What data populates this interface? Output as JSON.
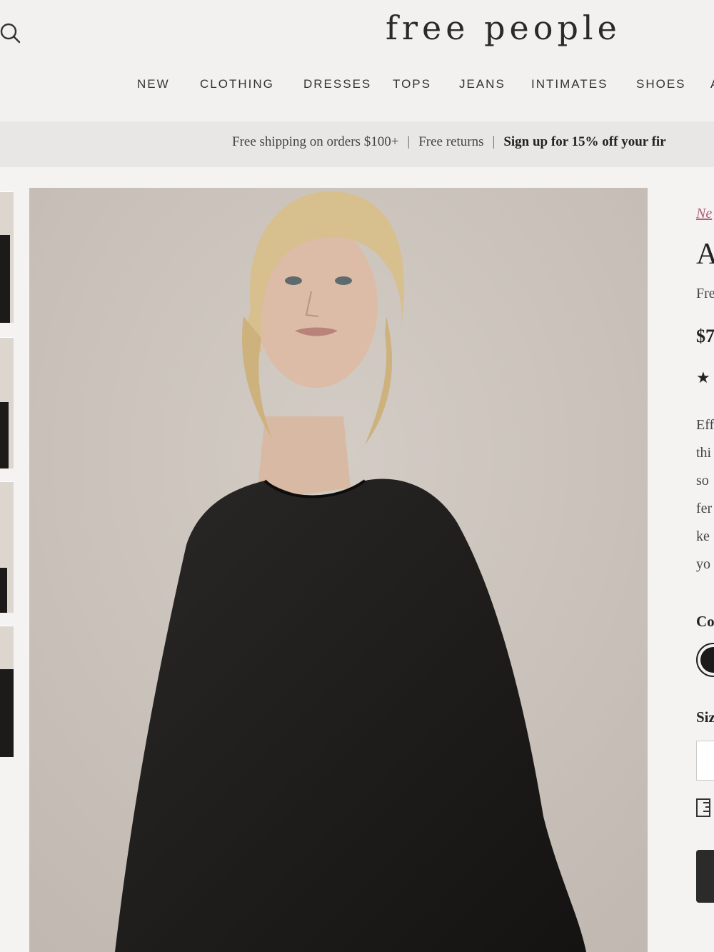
{
  "header": {
    "logo": "free people",
    "nav": [
      "NEW",
      "CLOTHING",
      "DRESSES",
      "TOPS",
      "JEANS",
      "INTIMATES",
      "SHOES",
      "A"
    ]
  },
  "banner": {
    "shipping": "Free shipping on orders $100+",
    "returns": "Free returns",
    "signup": "Sign up for 15% off your fir"
  },
  "product": {
    "breadcrumb": "Ne",
    "title": "A",
    "brand": "Fre",
    "price": "$7",
    "rating_star": "★",
    "description_lines": [
      "Eff",
      "thi",
      "so",
      "fer",
      "ke",
      "yo"
    ],
    "color_label": "Co",
    "size_label": "Siz"
  },
  "colors": {
    "background": "#f1efed",
    "banner_bg": "#e9e7e5",
    "product_color": "#1b1b1b",
    "breadcrumb": "#b0607a"
  },
  "icons": {
    "search": "search-icon",
    "size_guide": "ruler-icon"
  }
}
